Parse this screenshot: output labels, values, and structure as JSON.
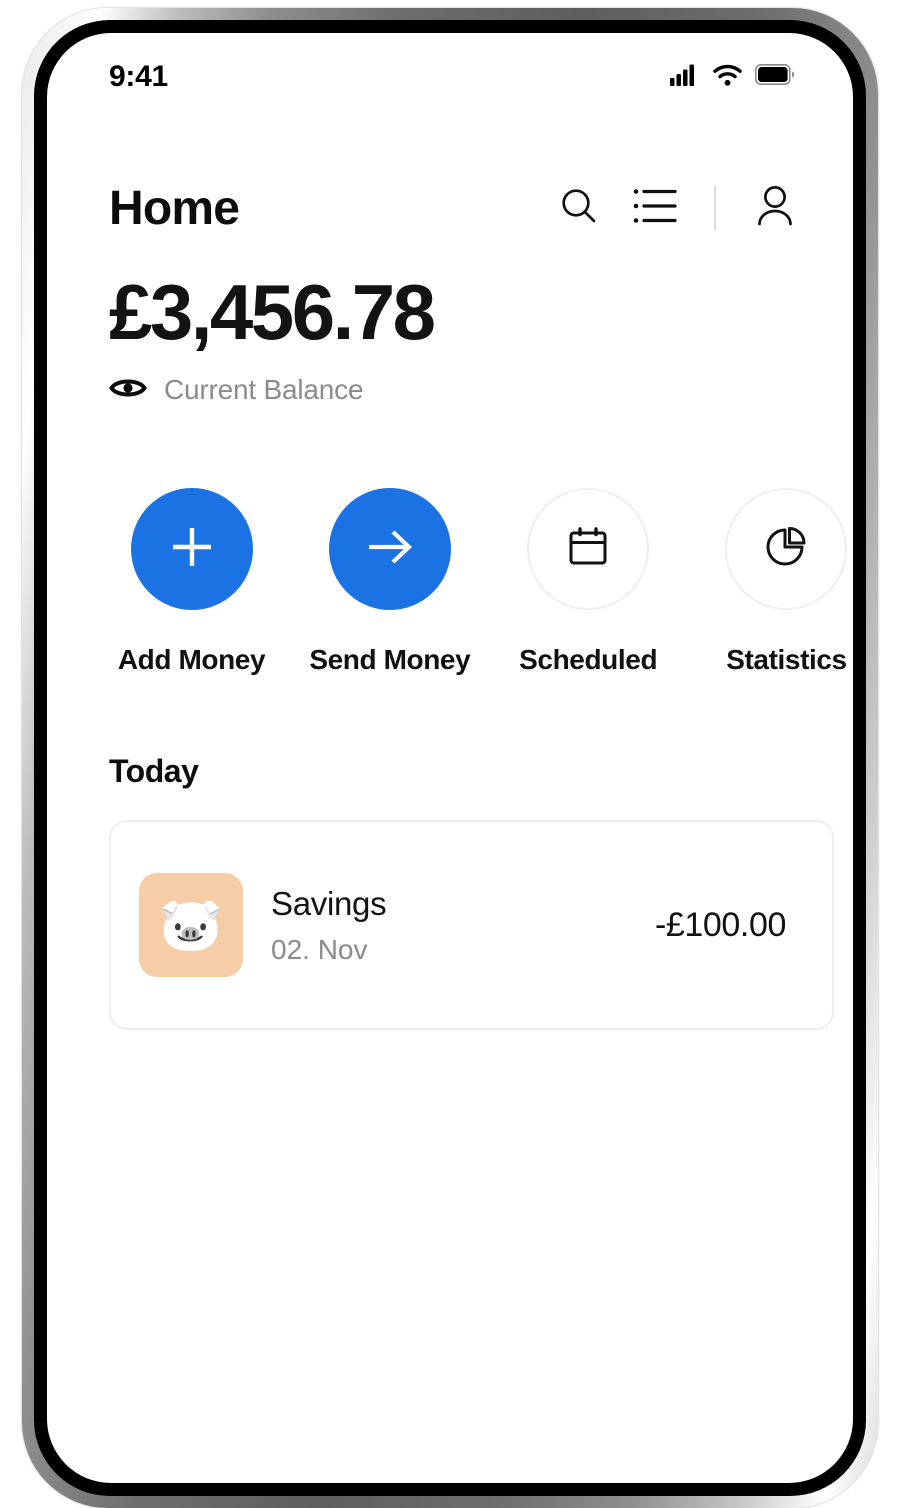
{
  "status_bar": {
    "time": "9:41",
    "cellular_icon": "cellular-signal-icon",
    "wifi_icon": "wifi-icon",
    "battery_icon": "battery-full-icon"
  },
  "header": {
    "title": "Home",
    "search_icon": "search-icon",
    "list_icon": "list-icon",
    "profile_icon": "person-icon"
  },
  "balance": {
    "amount": "£3,456.78",
    "label": "Current Balance",
    "visibility_icon": "eye-icon"
  },
  "quick_actions": [
    {
      "label": "Add Money",
      "icon": "plus-icon",
      "style": "filled",
      "color": "#1B73E3"
    },
    {
      "label": "Send Money",
      "icon": "arrow-right-icon",
      "style": "filled",
      "color": "#1B73E3"
    },
    {
      "label": "Scheduled",
      "icon": "calendar-icon",
      "style": "outline",
      "color": "#EFEFEF"
    },
    {
      "label": "Statistics",
      "icon": "pie-chart-icon",
      "style": "outline",
      "color": "#EFEFEF"
    }
  ],
  "transactions": {
    "section_title": "Today",
    "items": [
      {
        "title": "Savings",
        "date": "02. Nov",
        "amount": "-£100.00",
        "icon": "piggy-bank-icon",
        "icon_glyph": "🐷",
        "avatar_color": "#F5CDA6"
      }
    ]
  }
}
